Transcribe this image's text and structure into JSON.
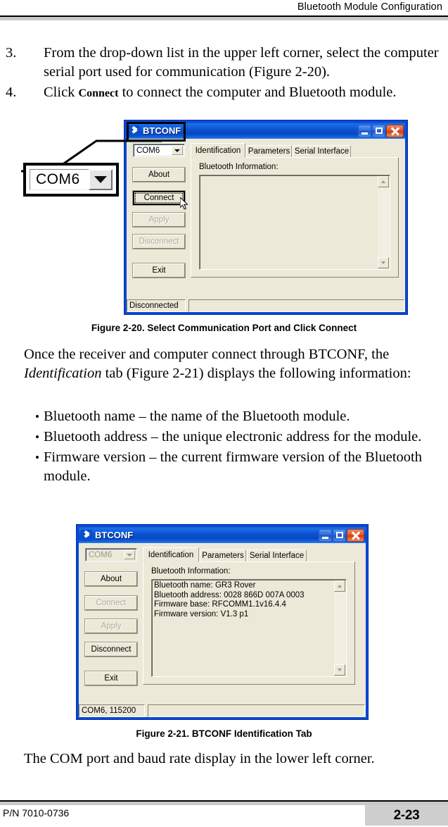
{
  "header": {
    "title": "Bluetooth Module Configuration"
  },
  "steps": [
    {
      "marker": "3.",
      "text_before": "From the drop-down list in the upper left corner, select the computer serial port used for communication (Figure 2-20).",
      "bold": "",
      "text_after": ""
    },
    {
      "marker": "4.",
      "text_before": "Click ",
      "bold": "Connect",
      "text_after": " to connect the computer and Bluetooth module."
    }
  ],
  "figure_20": {
    "caption": "Figure 2-20. Select Communication Port and Click Connect",
    "window": {
      "title": "BTCONF",
      "icon": "bluetooth-icon",
      "minimize": "minimize-icon",
      "maximize": "maximize-icon",
      "close": "close-icon",
      "combo_value": "COM6",
      "buttons": [
        {
          "label": "About",
          "state": "enabled"
        },
        {
          "label": "Connect",
          "state": "default-focused"
        },
        {
          "label": "Apply",
          "state": "disabled"
        },
        {
          "label": "Disconnect",
          "state": "disabled"
        },
        {
          "label": "Exit",
          "state": "enabled"
        }
      ],
      "tabs": [
        {
          "label": "Identification",
          "active": true
        },
        {
          "label": "Parameters",
          "active": false
        },
        {
          "label": "Serial Interface",
          "active": false
        }
      ],
      "group_label": "Bluetooth Information:",
      "info_lines": [],
      "status_left": "Disconnected",
      "status_right": ""
    },
    "callout": {
      "value": "COM6",
      "arrow_icon": "chevron-down-icon"
    }
  },
  "paragraph_1": {
    "line_1": "Once the receiver and computer connect through BTCONF, the",
    "italic": "Identification",
    "line_2": " tab (Figure 2-21) displays the following information:"
  },
  "bullets": [
    "Bluetooth name – the name of the Bluetooth module.",
    "Bluetooth address – the unique electronic address for the module.",
    "Firmware version – the current firmware version of the Bluetooth module."
  ],
  "figure_21": {
    "caption": "Figure 2-21. BTCONF Identification Tab",
    "window": {
      "title": "BTCONF",
      "icon": "bluetooth-icon",
      "minimize": "minimize-icon",
      "maximize": "maximize-icon",
      "close": "close-icon",
      "combo_value": "COM6",
      "combo_state": "disabled",
      "buttons": [
        {
          "label": "About",
          "state": "enabled"
        },
        {
          "label": "Connect",
          "state": "disabled"
        },
        {
          "label": "Apply",
          "state": "disabled"
        },
        {
          "label": "Disconnect",
          "state": "enabled"
        },
        {
          "label": "Exit",
          "state": "enabled"
        }
      ],
      "tabs": [
        {
          "label": "Identification",
          "active": true
        },
        {
          "label": "Parameters",
          "active": false
        },
        {
          "label": "Serial Interface",
          "active": false
        }
      ],
      "group_label": "Bluetooth Information:",
      "info_text": "Bluetooth name: GR3 Rover\nBluetooth address: 0028 866D 007A 0003\nFirmware base: RFCOMM1.1v16.4.4\nFirmware version: V1.3 p1",
      "status_left": "COM6, 115200",
      "status_right": ""
    }
  },
  "paragraph_2": "The COM port and baud rate display in the lower left corner.",
  "footer": {
    "part_number": "P/N 7010-0736",
    "page_number": "2-23"
  },
  "colors": {
    "title_gradient_start": "#0a59d6",
    "title_gradient_end": "#2f82f0",
    "dialog_face": "#ece9d8",
    "close_button": "#e05423",
    "header_rule": "#c9c9c9"
  }
}
